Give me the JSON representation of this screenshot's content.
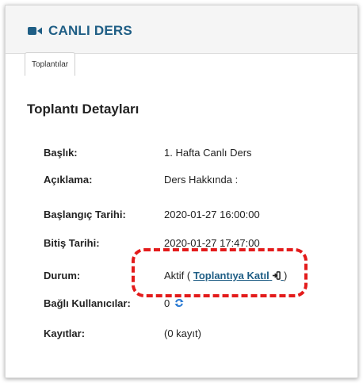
{
  "header": {
    "title": "CANLI DERS",
    "icon": "video-camera-icon"
  },
  "tabs": [
    {
      "label": "Toplantılar"
    }
  ],
  "section": {
    "title": "Toplantı Detayları"
  },
  "details": [
    {
      "label": "Başlık:",
      "value": "1. Hafta Canlı Ders"
    },
    {
      "label": "Açıklama:",
      "value": "Ders Hakkında :"
    },
    {
      "label": "Başlangıç Tarihi:",
      "value": "2020-01-27 16:00:00"
    },
    {
      "label": "Bitiş Tarihi:",
      "value": "2020-01-27 17:47:00"
    },
    {
      "label": "Durum:",
      "value_prefix": "Aktif (",
      "link": "Toplantıya Katıl",
      "link_icon": "sign-in-icon",
      "value_suffix": ")"
    },
    {
      "label": "Bağlı Kullanıcılar:",
      "value": "0",
      "icon": "refresh-icon"
    },
    {
      "label": "Kayıtlar:",
      "value": "(0 kayıt)"
    }
  ],
  "colors": {
    "accent": "#1f5e85",
    "annotation": "#e31b1b"
  }
}
